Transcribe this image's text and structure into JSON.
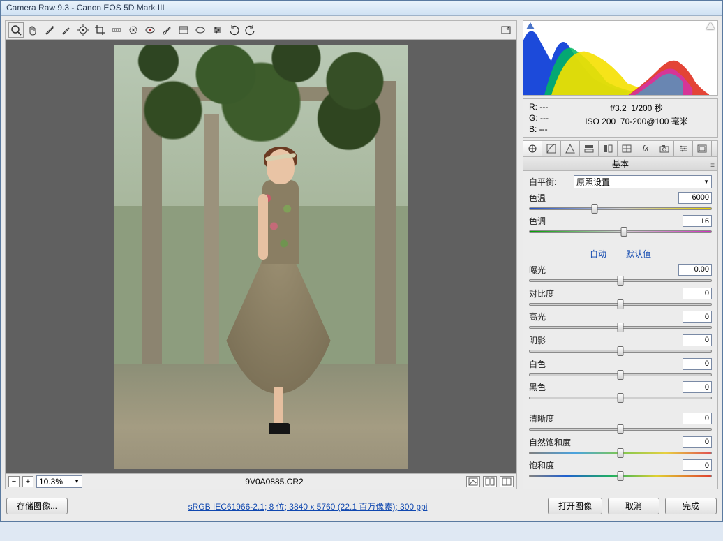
{
  "window": {
    "title": "Camera Raw 9.3  -  Canon EOS 5D Mark III"
  },
  "preview": {
    "zoom": "10.3%",
    "filename": "9V0A0885.CR2"
  },
  "readout": {
    "r": "R:   ---",
    "g": "G:   ---",
    "b": "B:   ---",
    "aperture": "f/3.2",
    "shutter": "1/200 秒",
    "iso": "ISO 200",
    "lens": "70-200@100 毫米"
  },
  "panel": {
    "title": "基本",
    "wb_label": "白平衡:",
    "wb_value": "原照设置",
    "auto": "自动",
    "default": "默认值",
    "sliders": {
      "temp": {
        "label": "色温",
        "value": "6000",
        "pos": 36
      },
      "tint": {
        "label": "色调",
        "value": "+6",
        "pos": 52
      },
      "exposure": {
        "label": "曝光",
        "value": "0.00",
        "pos": 50
      },
      "contrast": {
        "label": "对比度",
        "value": "0",
        "pos": 50
      },
      "highlights": {
        "label": "高光",
        "value": "0",
        "pos": 50
      },
      "shadows": {
        "label": "阴影",
        "value": "0",
        "pos": 50
      },
      "whites": {
        "label": "白色",
        "value": "0",
        "pos": 50
      },
      "blacks": {
        "label": "黑色",
        "value": "0",
        "pos": 50
      },
      "clarity": {
        "label": "清晰度",
        "value": "0",
        "pos": 50
      },
      "vibrance": {
        "label": "自然饱和度",
        "value": "0",
        "pos": 50
      },
      "saturation": {
        "label": "饱和度",
        "value": "0",
        "pos": 50
      }
    }
  },
  "footer": {
    "save": "存储图像...",
    "info": "sRGB IEC61966-2.1; 8 位; 3840 x 5760 (22.1 百万像素); 300 ppi",
    "open": "打开图像",
    "cancel": "取消",
    "done": "完成"
  }
}
